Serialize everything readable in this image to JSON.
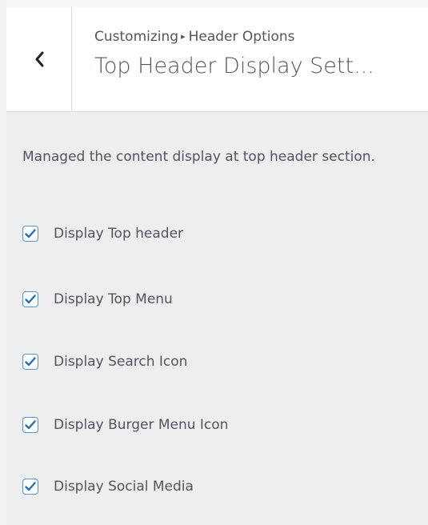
{
  "header": {
    "back_icon": "chevron-left-icon",
    "breadcrumb": {
      "root": "Customizing",
      "separator": "▸",
      "section": "Header Options"
    },
    "title": "Top Header Display Sett..."
  },
  "section": {
    "description": "Managed the content display at top header section.",
    "options": [
      {
        "label": "Display Top header",
        "checked": true
      },
      {
        "label": "Display Top Menu",
        "checked": true
      },
      {
        "label": "Display Search Icon",
        "checked": true
      },
      {
        "label": "Display Burger Menu Icon",
        "checked": true
      },
      {
        "label": "Display Social Media",
        "checked": true
      }
    ]
  },
  "colors": {
    "panel_background": "#eeeeee",
    "header_background": "#ffffff",
    "text": "#50575e",
    "checkbox_accent": "#2271b1"
  }
}
